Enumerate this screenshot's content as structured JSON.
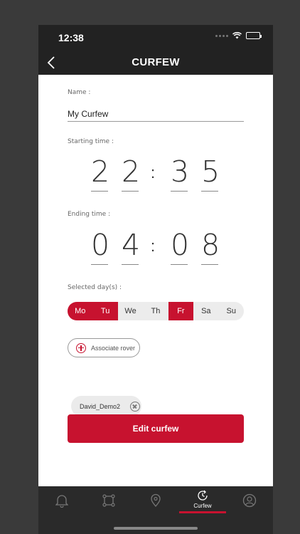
{
  "status": {
    "time": "12:38"
  },
  "header": {
    "title": "CURFEW"
  },
  "form": {
    "name_label": "Name :",
    "name_value": "My Curfew",
    "start_label": "Starting time :",
    "start_time": [
      "2",
      "2",
      "3",
      "5"
    ],
    "end_label": "Ending time :",
    "end_time": [
      "0",
      "4",
      "0",
      "8"
    ],
    "colon": ":",
    "days_label": "Selected day(s) :",
    "days": [
      {
        "label": "Mo",
        "selected": true
      },
      {
        "label": "Tu",
        "selected": true
      },
      {
        "label": "We",
        "selected": false
      },
      {
        "label": "Th",
        "selected": false
      },
      {
        "label": "Fr",
        "selected": true
      },
      {
        "label": "Sa",
        "selected": false
      },
      {
        "label": "Su",
        "selected": false
      }
    ],
    "associate_label": "Associate rover",
    "rover_chip": "David_Demo2",
    "edit_button": "Edit curfew"
  },
  "tabs": [
    {
      "icon": "bell-icon",
      "label": ""
    },
    {
      "icon": "geofence-icon",
      "label": ""
    },
    {
      "icon": "map-pin-icon",
      "label": ""
    },
    {
      "icon": "curfew-clock-icon",
      "label": "Curfew",
      "active": true
    },
    {
      "icon": "user-icon",
      "label": ""
    }
  ],
  "colors": {
    "accent": "#c7122f",
    "bar": "#222222"
  }
}
